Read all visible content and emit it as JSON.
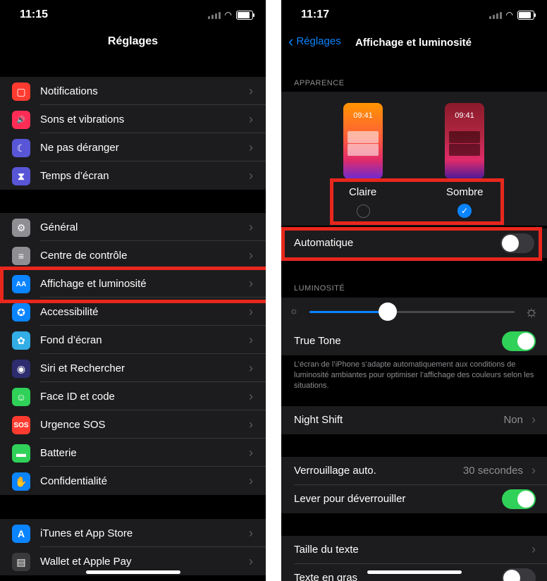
{
  "left": {
    "status": {
      "time": "11:15"
    },
    "title": "Réglages",
    "groups": [
      [
        {
          "label": "Notifications",
          "icon": "notifications-icon",
          "color": "#ff3b30",
          "glyph": "▢"
        },
        {
          "label": "Sons et vibrations",
          "icon": "speaker-icon",
          "color": "#ff2d55",
          "glyph": "🔊"
        },
        {
          "label": "Ne pas déranger",
          "icon": "moon-icon",
          "color": "#5856d6",
          "glyph": "☾"
        },
        {
          "label": "Temps d’écran",
          "icon": "hourglass-icon",
          "color": "#5856d6",
          "glyph": "⧗"
        }
      ],
      [
        {
          "label": "Général",
          "icon": "gear-icon",
          "color": "#8e8e93",
          "glyph": "⚙"
        },
        {
          "label": "Centre de contrôle",
          "icon": "toggles-icon",
          "color": "#8e8e93",
          "glyph": "≡"
        },
        {
          "label": "Affichage et luminosité",
          "icon": "display-icon",
          "color": "#0a84ff",
          "glyph": "AA"
        },
        {
          "label": "Accessibilité",
          "icon": "accessibility-icon",
          "color": "#0a84ff",
          "glyph": "✪"
        },
        {
          "label": "Fond d’écran",
          "icon": "wallpaper-icon",
          "color": "#32ade6",
          "glyph": "✿"
        },
        {
          "label": "Siri et Rechercher",
          "icon": "siri-icon",
          "color": "#2c2c6e",
          "glyph": "◉"
        },
        {
          "label": "Face ID et code",
          "icon": "faceid-icon",
          "color": "#30d158",
          "glyph": "☺"
        },
        {
          "label": "Urgence SOS",
          "icon": "sos-icon",
          "color": "#ff3b30",
          "glyph": "SOS"
        },
        {
          "label": "Batterie",
          "icon": "battery-icon",
          "color": "#30d158",
          "glyph": "▬"
        },
        {
          "label": "Confidentialité",
          "icon": "hand-icon",
          "color": "#0a84ff",
          "glyph": "✋"
        }
      ],
      [
        {
          "label": "iTunes et App Store",
          "icon": "app-store-icon",
          "color": "#0a84ff",
          "glyph": "A"
        },
        {
          "label": "Wallet et Apple Pay",
          "icon": "wallet-icon",
          "color": "#3a3a3c",
          "glyph": "▤"
        }
      ]
    ]
  },
  "right": {
    "status": {
      "time": "11:17"
    },
    "back_label": "Réglages",
    "title": "Affichage et luminosité",
    "appearance_header": "APPARENCE",
    "mock_time": "09:41",
    "light_label": "Claire",
    "dark_label": "Sombre",
    "automatic_label": "Automatique",
    "automatic_on": false,
    "brightness_header": "LUMINOSITÉ",
    "brightness_level": 0.38,
    "true_tone_label": "True Tone",
    "true_tone_on": true,
    "true_tone_desc": "L’écran de l’iPhone s’adapte automatiquement aux conditions de luminosité ambiantes pour optimiser l’affichage des couleurs selon les situations.",
    "night_shift_label": "Night Shift",
    "night_shift_value": "Non",
    "auto_lock_label": "Verrouillage auto.",
    "auto_lock_value": "30 secondes",
    "raise_label": "Lever pour déverrouiller",
    "raise_on": true,
    "text_size_label": "Taille du texte",
    "bold_label": "Texte en gras",
    "bold_on": false
  },
  "colors": {
    "highlight": "#e8271d",
    "accent": "#0a84ff",
    "switch_on": "#30d158"
  }
}
